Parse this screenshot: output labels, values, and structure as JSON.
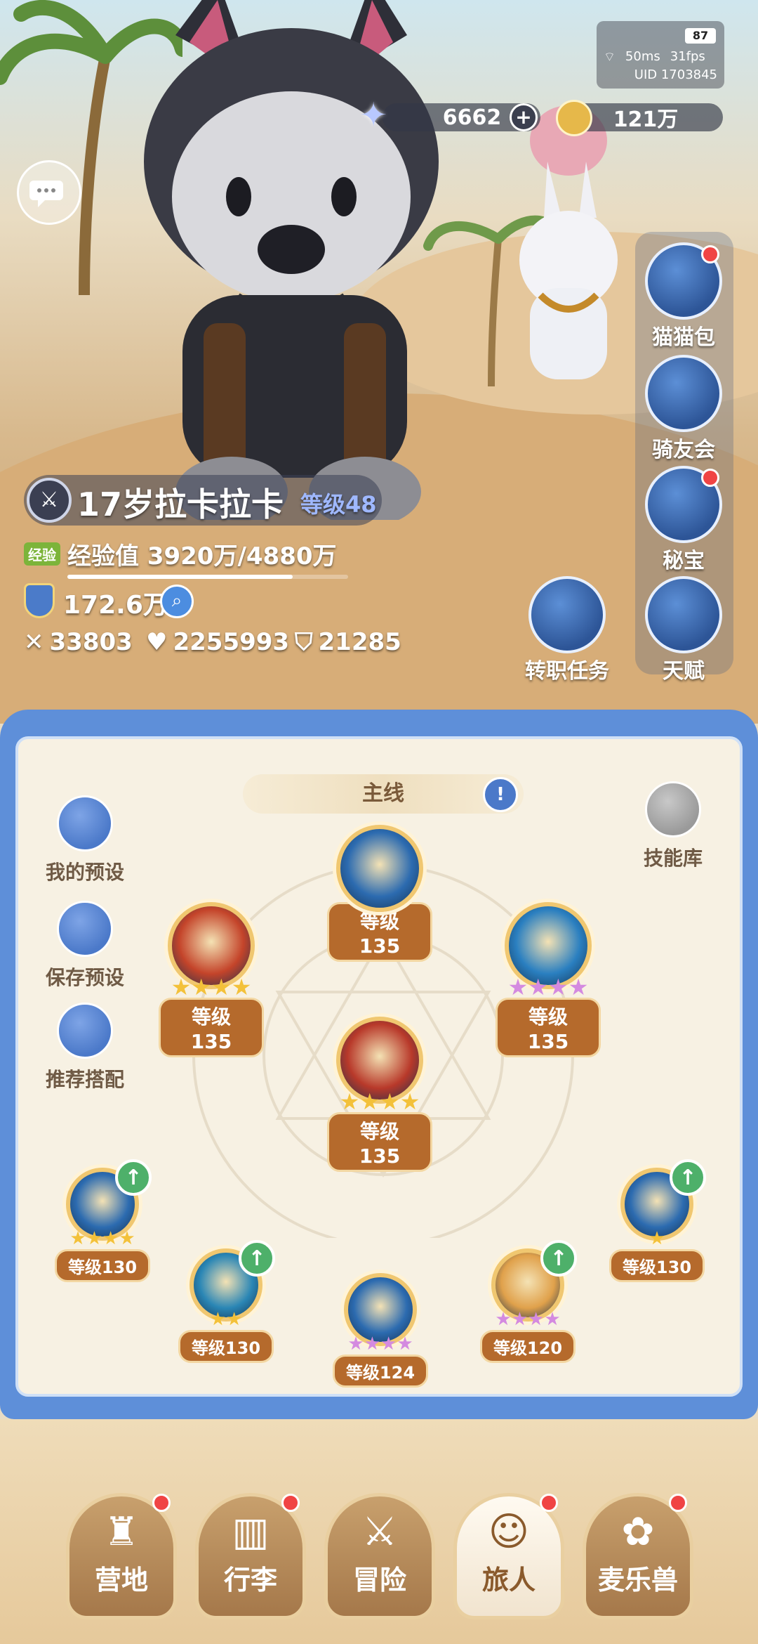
{
  "hud": {
    "battery": "87",
    "ping": "50ms",
    "fps": "31fps",
    "uid": "UID 1703845"
  },
  "currency": {
    "stars": "6662",
    "plus": "+",
    "coins": "121万"
  },
  "side_menu": [
    {
      "label": "猫猫包",
      "icon": "cat-bag-icon",
      "badge": true
    },
    {
      "label": "骑友会",
      "icon": "horse-head-icon",
      "badge": false
    },
    {
      "label": "秘宝",
      "icon": "treasure-chest-icon",
      "badge": true
    },
    {
      "label": "天赋",
      "icon": "talent-head-icon",
      "badge": false
    }
  ],
  "job_quest": {
    "label": "转职任务"
  },
  "player": {
    "name": "17岁拉卡拉卡",
    "level": "等级48",
    "exp_tag": "经验",
    "exp_text": "经验值 3920万/4880万",
    "exp_fraction": 0.803,
    "power": "172.6万",
    "attack": "33803",
    "hp": "2255993",
    "defense": "21285"
  },
  "panel": {
    "tab_title": "主线",
    "left_buttons": [
      "我的预设",
      "保存预设",
      "推荐搭配"
    ],
    "skill_library": "技能库",
    "skills": [
      {
        "level": "等级135",
        "stars": 0,
        "star_color": "#f3c13a",
        "color": "#2c6bb0"
      },
      {
        "level": "等级135",
        "stars": 4,
        "star_color": "#f3c13a",
        "color": "#c4442a"
      },
      {
        "level": "等级135",
        "stars": 4,
        "star_color": "#d48ae0",
        "color": "#2a7fc0"
      },
      {
        "level": "等级135",
        "stars": 4,
        "star_color": "#f3c13a",
        "color": "#b8392a"
      },
      {
        "level": "等级130",
        "stars": 4,
        "star_color": "#f3c13a",
        "color": "#2c6bb0",
        "upgrade": true
      },
      {
        "level": "等级130",
        "stars": 2,
        "star_color": "#f3c13a",
        "color": "#2a86b5",
        "upgrade": true
      },
      {
        "level": "等级124",
        "stars": 4,
        "star_color": "#d48ae0",
        "color": "#2c6bb0"
      },
      {
        "level": "等级120",
        "stars": 4,
        "star_color": "#d48ae0",
        "color": "#e0a14b",
        "upgrade": true
      },
      {
        "level": "等级130",
        "stars": 1,
        "star_color": "#f3c13a",
        "color": "#2c6bb0",
        "upgrade": true
      }
    ]
  },
  "nav": [
    {
      "label": "营地",
      "badge": true,
      "active": false
    },
    {
      "label": "行李",
      "badge": true,
      "active": false
    },
    {
      "label": "冒险",
      "badge": false,
      "active": false
    },
    {
      "label": "旅人",
      "badge": true,
      "active": true
    },
    {
      "label": "麦乐兽",
      "badge": true,
      "active": false
    }
  ]
}
